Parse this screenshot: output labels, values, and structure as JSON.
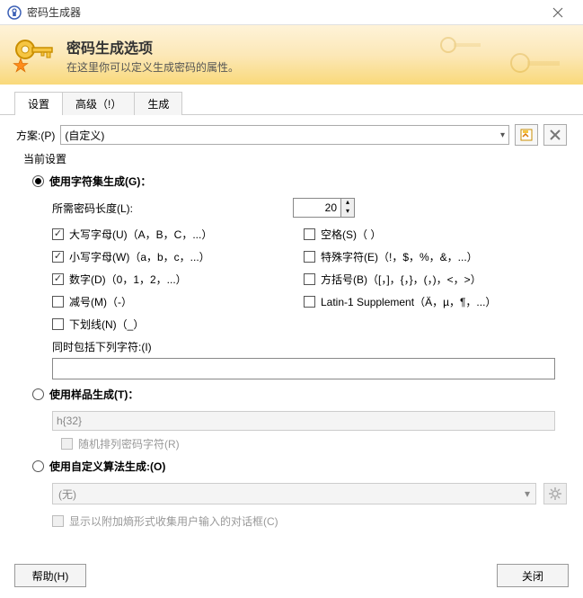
{
  "window": {
    "title": "密码生成器"
  },
  "banner": {
    "heading": "密码生成选项",
    "sub": "在这里你可以定义生成密码的属性。"
  },
  "tabs": {
    "t1": "设置",
    "t2": "高级（!）",
    "t3": "生成"
  },
  "scheme": {
    "label": "方案:(P)",
    "value": "(自定义)"
  },
  "group": {
    "current": "当前设置"
  },
  "radios": {
    "charset": "使用字符集生成(G)：",
    "pattern": "使用样品生成(T)：",
    "algo": "使用自定义算法生成:(O)"
  },
  "len": {
    "label": "所需密码长度(L):",
    "value": "20"
  },
  "checks": {
    "upper": "大写字母(U)（A，B，C，...）",
    "space": "空格(S)（ ）",
    "lower": "小写字母(W)（a，b，c，...）",
    "special": "特殊字符(E)（!，$，%，&，...）",
    "digit": "数字(D)（0，1，2，...）",
    "bracket": "方括号(B)（[，]，{，}，(，)，<，>）",
    "minus": "减号(M)（-）",
    "latin": "Latin-1 Supplement（Ä，µ，¶，...）",
    "underscore": "下划线(N)（_）"
  },
  "also": {
    "label": "同时包括下列字符:(I)"
  },
  "pattern": {
    "value": "h{32}",
    "random": "随机排列密码字符(R)"
  },
  "algo": {
    "value": "(无)"
  },
  "entropy": {
    "label": "显示以附加熵形式收集用户输入的对话框(C)"
  },
  "footer": {
    "help": "帮助(H)",
    "close": "关闭"
  }
}
